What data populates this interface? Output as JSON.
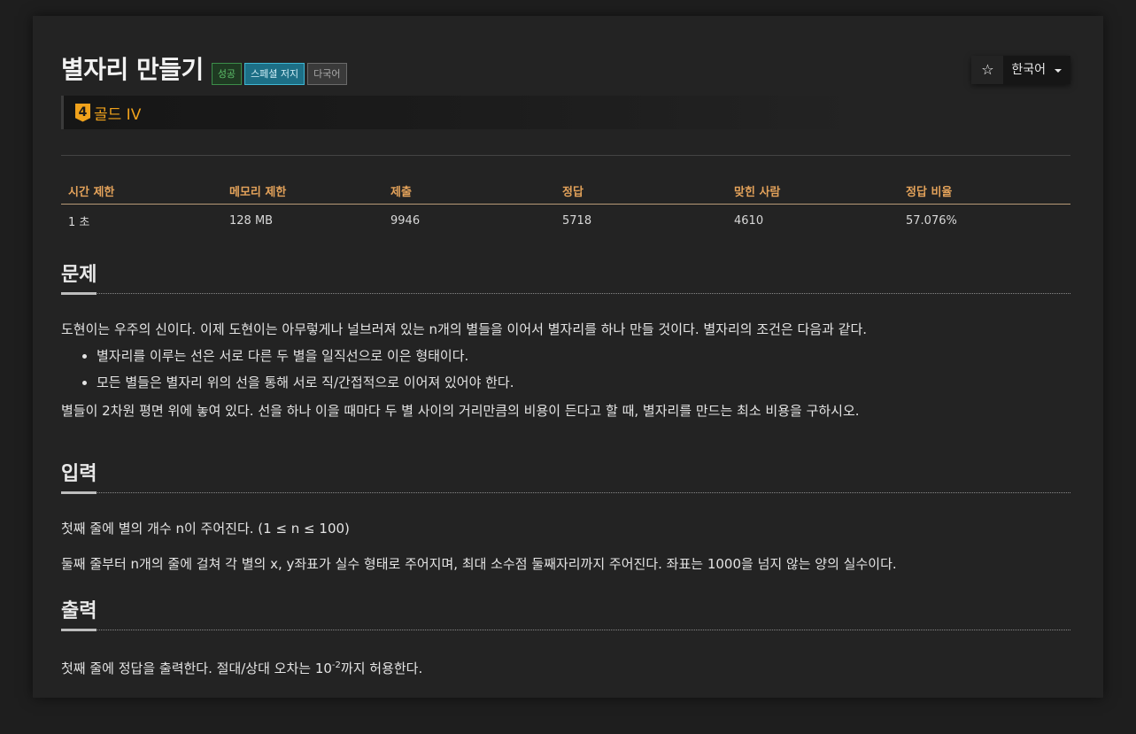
{
  "problem": {
    "title": "별자리 만들기",
    "badges": {
      "success": "성공",
      "special_judge": "스페셜 저지",
      "multilang": "다국어"
    },
    "tier": {
      "icon_number": "4",
      "label": "골드 IV",
      "color": "#f0a21c"
    }
  },
  "actions": {
    "star_glyph": "☆",
    "language": "한국어"
  },
  "stats": {
    "headers": [
      "시간 제한",
      "메모리 제한",
      "제출",
      "정답",
      "맞힌 사람",
      "정답 비율"
    ],
    "values": [
      "1 초",
      "128 MB",
      "9946",
      "5718",
      "4610",
      "57.076%"
    ]
  },
  "sections": {
    "description": {
      "title": "문제",
      "intro": "도현이는 우주의 신이다. 이제 도현이는 아무렇게나 널브러져 있는 n개의 별들을 이어서 별자리를 하나 만들 것이다. 별자리의 조건은 다음과 같다.",
      "bullets": [
        "별자리를 이루는 선은 서로 다른 두 별을 일직선으로 이은 형태이다.",
        "모든 별들은 별자리 위의 선을 통해 서로 직/간접적으로 이어져 있어야 한다."
      ],
      "outro": "별들이 2차원 평면 위에 놓여 있다. 선을 하나 이을 때마다 두 별 사이의 거리만큼의 비용이 든다고 할 때, 별자리를 만드는 최소 비용을 구하시오."
    },
    "input": {
      "title": "입력",
      "lines": [
        "첫째 줄에 별의 개수 n이 주어진다. (1 ≤ n ≤ 100)",
        "둘째 줄부터 n개의 줄에 걸쳐 각 별의 x, y좌표가 실수 형태로 주어지며, 최대 소수점 둘째자리까지 주어진다. 좌표는 1000을 넘지 않는 양의 실수이다."
      ]
    },
    "output": {
      "title": "출력",
      "text_before": "첫째 줄에 정답을 출력한다. 절대/상대 오차는 10",
      "exponent": "-2",
      "text_after": "까지 허용한다."
    }
  }
}
